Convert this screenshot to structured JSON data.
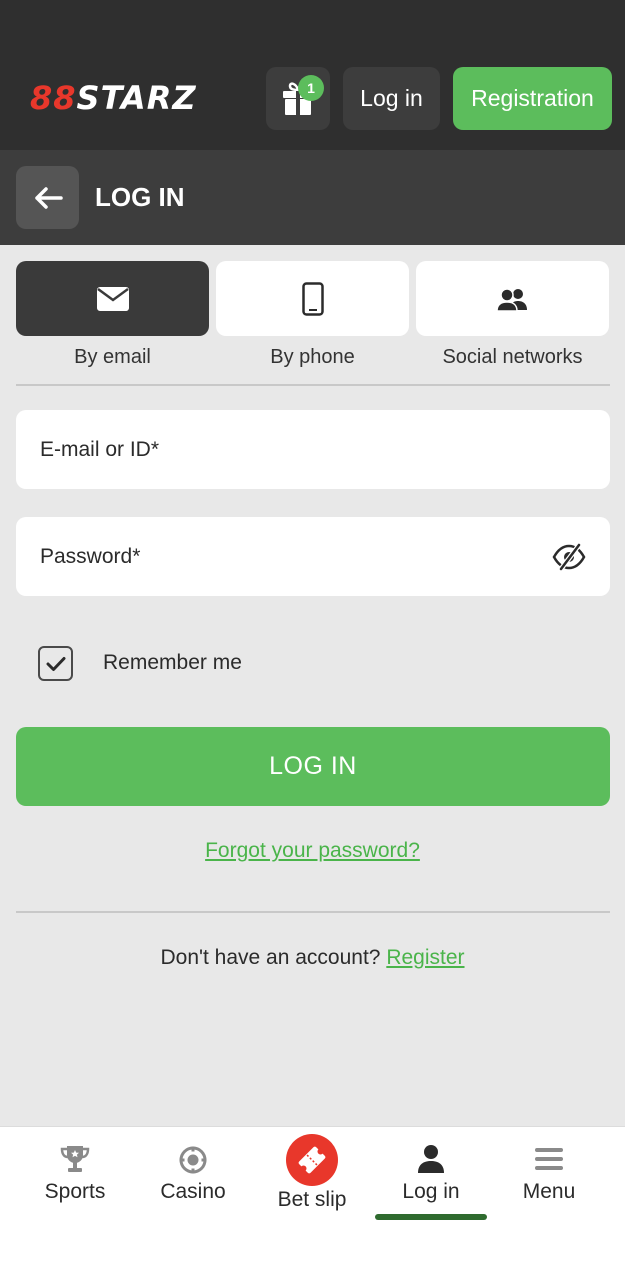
{
  "header": {
    "logo_mark": "88",
    "logo_text": "STARZ",
    "gift_badge_count": "1",
    "login_label": "Log in",
    "registration_label": "Registration"
  },
  "page": {
    "title": "LOG IN"
  },
  "methods": [
    {
      "label": "By email",
      "icon": "envelope-icon",
      "active": true
    },
    {
      "label": "By phone",
      "icon": "phone-icon",
      "active": false
    },
    {
      "label": "Social networks",
      "icon": "people-icon",
      "active": false
    }
  ],
  "form": {
    "email_placeholder": "E-mail or ID*",
    "email_value": "",
    "password_placeholder": "Password*",
    "password_value": "",
    "remember_label": "Remember me",
    "remember_checked": true,
    "submit_label": "LOG IN",
    "forgot_label": "Forgot your password?",
    "signup_prompt": "Don't have an account?",
    "register_label": "Register"
  },
  "bottom_nav": [
    {
      "label": "Sports",
      "icon": "trophy-icon"
    },
    {
      "label": "Casino",
      "icon": "casino-chip-icon"
    },
    {
      "label": "Bet slip",
      "icon": "ticket-icon"
    },
    {
      "label": "Log in",
      "icon": "user-icon",
      "active": true
    },
    {
      "label": "Menu",
      "icon": "hamburger-icon"
    }
  ],
  "colors": {
    "brand_green": "#5cbd5c",
    "brand_red": "#e8372b",
    "header_dark": "#2f2f2f",
    "active_indicator": "#2f6b2f"
  }
}
